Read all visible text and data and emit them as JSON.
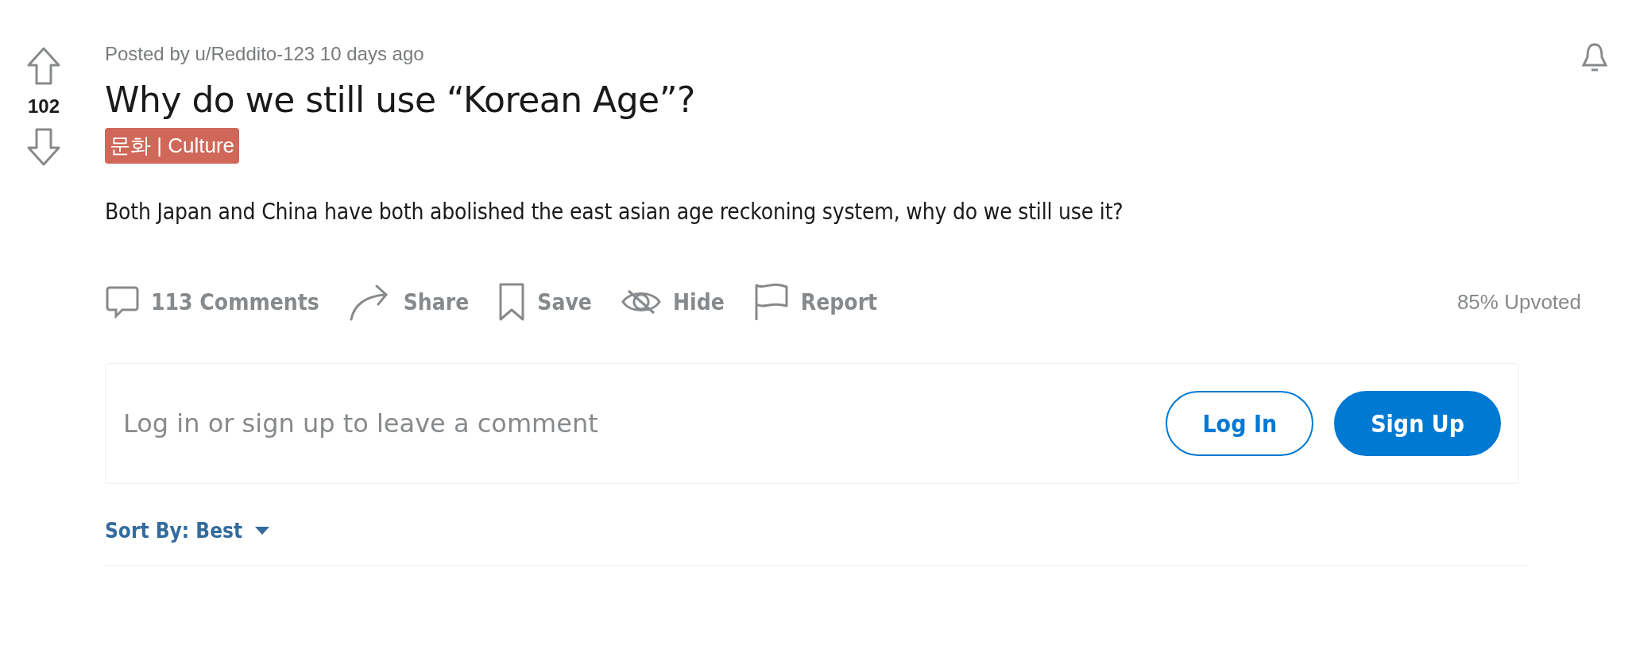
{
  "vote": {
    "score": "102"
  },
  "post": {
    "meta": "Posted by u/Reddito-123 10 days ago",
    "title": "Why do we still use “Korean Age”?",
    "flair": {
      "label": "문화 | Culture",
      "color": "#d0685a"
    },
    "body": "Both Japan and China have both abolished the east asian age reckoning system, why do we still use it?"
  },
  "actions": [
    {
      "kind": "comment",
      "label": "113 Comments"
    },
    {
      "kind": "share",
      "label": "Share"
    },
    {
      "kind": "save",
      "label": "Save"
    },
    {
      "kind": "hide",
      "label": "Hide"
    },
    {
      "kind": "report",
      "label": "Report"
    }
  ],
  "upvote_ratio": "85% Upvoted",
  "comment_box": {
    "prompt": "Log in or sign up to leave a comment",
    "buttons": [
      {
        "kind": "outline",
        "label": "Log In"
      },
      {
        "kind": "filled",
        "label": "Sign Up"
      }
    ]
  },
  "sort": {
    "label": "Sort By: Best"
  }
}
